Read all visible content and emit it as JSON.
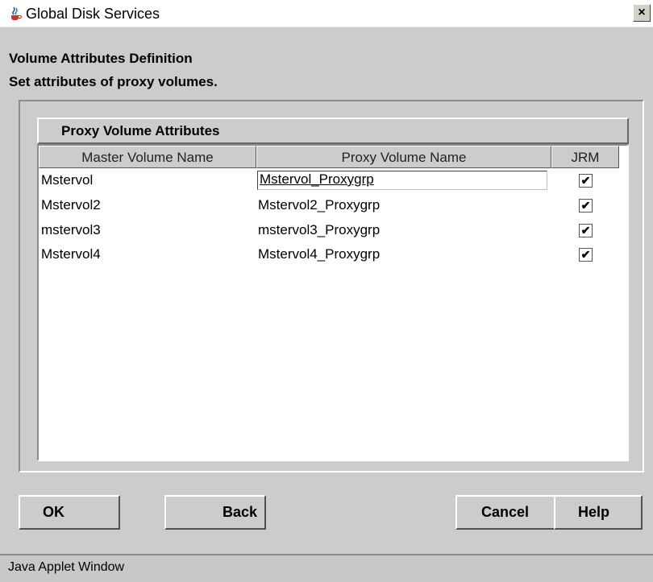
{
  "window": {
    "title": "Global Disk Services",
    "close_label": "×",
    "icon": "java-cup-icon"
  },
  "headings": {
    "title": "Volume Attributes Definition",
    "subtitle": "Set attributes of proxy volumes."
  },
  "group": {
    "title": "Proxy Volume Attributes"
  },
  "table": {
    "columns": [
      "Master Volume Name",
      "Proxy Volume Name",
      "JRM"
    ],
    "rows": [
      {
        "master": "Mstervol",
        "proxy": "Mstervol_Proxygrp",
        "jrm": true,
        "editing": true
      },
      {
        "master": "Mstervol2",
        "proxy": "Mstervol2_Proxygrp",
        "jrm": true
      },
      {
        "master": "mstervol3",
        "proxy": "mstervol3_Proxygrp",
        "jrm": true
      },
      {
        "master": "Mstervol4",
        "proxy": "Mstervol4_Proxygrp",
        "jrm": true
      }
    ]
  },
  "buttons": {
    "ok": "OK",
    "back": "Back",
    "cancel": "Cancel",
    "help": "Help"
  },
  "status": {
    "text": "Java Applet Window"
  },
  "colors": {
    "background": "#cccccc",
    "table_background": "#ffffff"
  }
}
